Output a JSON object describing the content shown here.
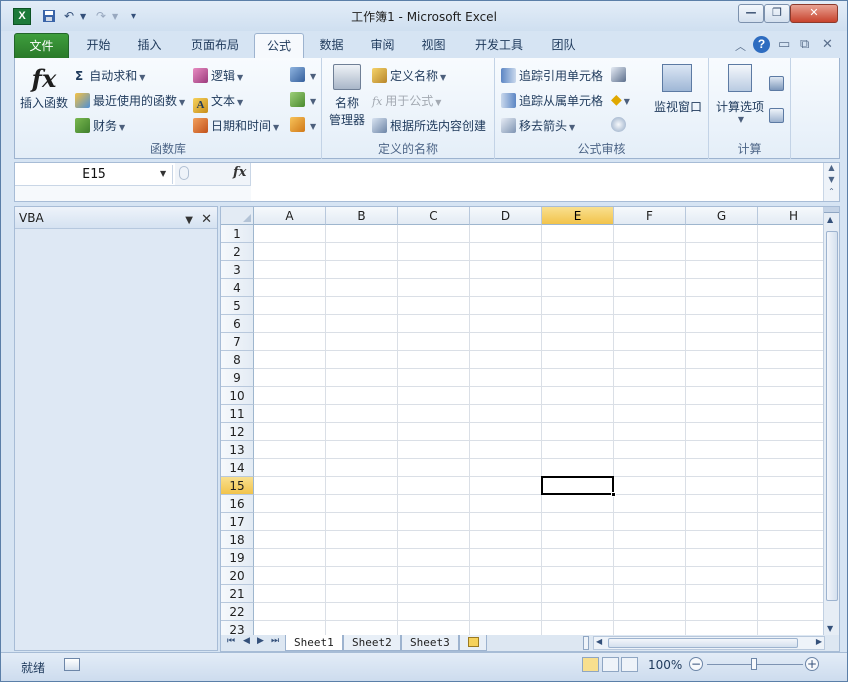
{
  "window": {
    "title": "工作簿1 - Microsoft Excel",
    "app_icon": "X",
    "minimize": "—",
    "restore": "❐",
    "close": "✕"
  },
  "qat": {
    "save_icon": "save-icon",
    "undo_icon": "undo-icon",
    "redo_icon": "redo-icon"
  },
  "tabs": [
    {
      "label": "文件"
    },
    {
      "label": "开始"
    },
    {
      "label": "插入"
    },
    {
      "label": "页面布局"
    },
    {
      "label": "公式"
    },
    {
      "label": "数据"
    },
    {
      "label": "审阅"
    },
    {
      "label": "视图"
    },
    {
      "label": "开发工具"
    },
    {
      "label": "团队"
    }
  ],
  "ribbon": {
    "function_library": {
      "label": "函数库",
      "insert_function": "插入函数",
      "autosum": "自动求和",
      "recent": "最近使用的函数",
      "financial": "财务",
      "logical": "逻辑",
      "text": "文本",
      "datetime": "日期和时间"
    },
    "defined_names": {
      "label": "定义的名称",
      "name_manager_1": "名称",
      "name_manager_2": "管理器",
      "define_name": "定义名称",
      "use_in_formula": "用于公式",
      "create_from_selection": "根据所选内容创建"
    },
    "formula_auditing": {
      "label": "公式审核",
      "trace_precedents": "追踪引用单元格",
      "trace_dependents": "追踪从属单元格",
      "remove_arrows": "移去箭头",
      "watch_window": "监视窗口"
    },
    "calculation": {
      "label": "计算",
      "options": "计算选项"
    }
  },
  "formula_bar": {
    "name_box": "E15",
    "fx": "fx",
    "value": ""
  },
  "vba_pane": {
    "title": "VBA"
  },
  "grid": {
    "columns": [
      "A",
      "B",
      "C",
      "D",
      "E",
      "F",
      "G",
      "H"
    ],
    "rows": [
      "1",
      "2",
      "3",
      "4",
      "5",
      "6",
      "7",
      "8",
      "9",
      "10",
      "11",
      "12",
      "13",
      "14",
      "15",
      "16",
      "17",
      "18",
      "19",
      "20",
      "21",
      "22",
      "23"
    ],
    "selected_col": "E",
    "selected_row": "15"
  },
  "sheets": [
    "Sheet1",
    "Sheet2",
    "Sheet3"
  ],
  "active_sheet": "Sheet1",
  "status": {
    "ready": "就绪",
    "zoom": "100%"
  }
}
